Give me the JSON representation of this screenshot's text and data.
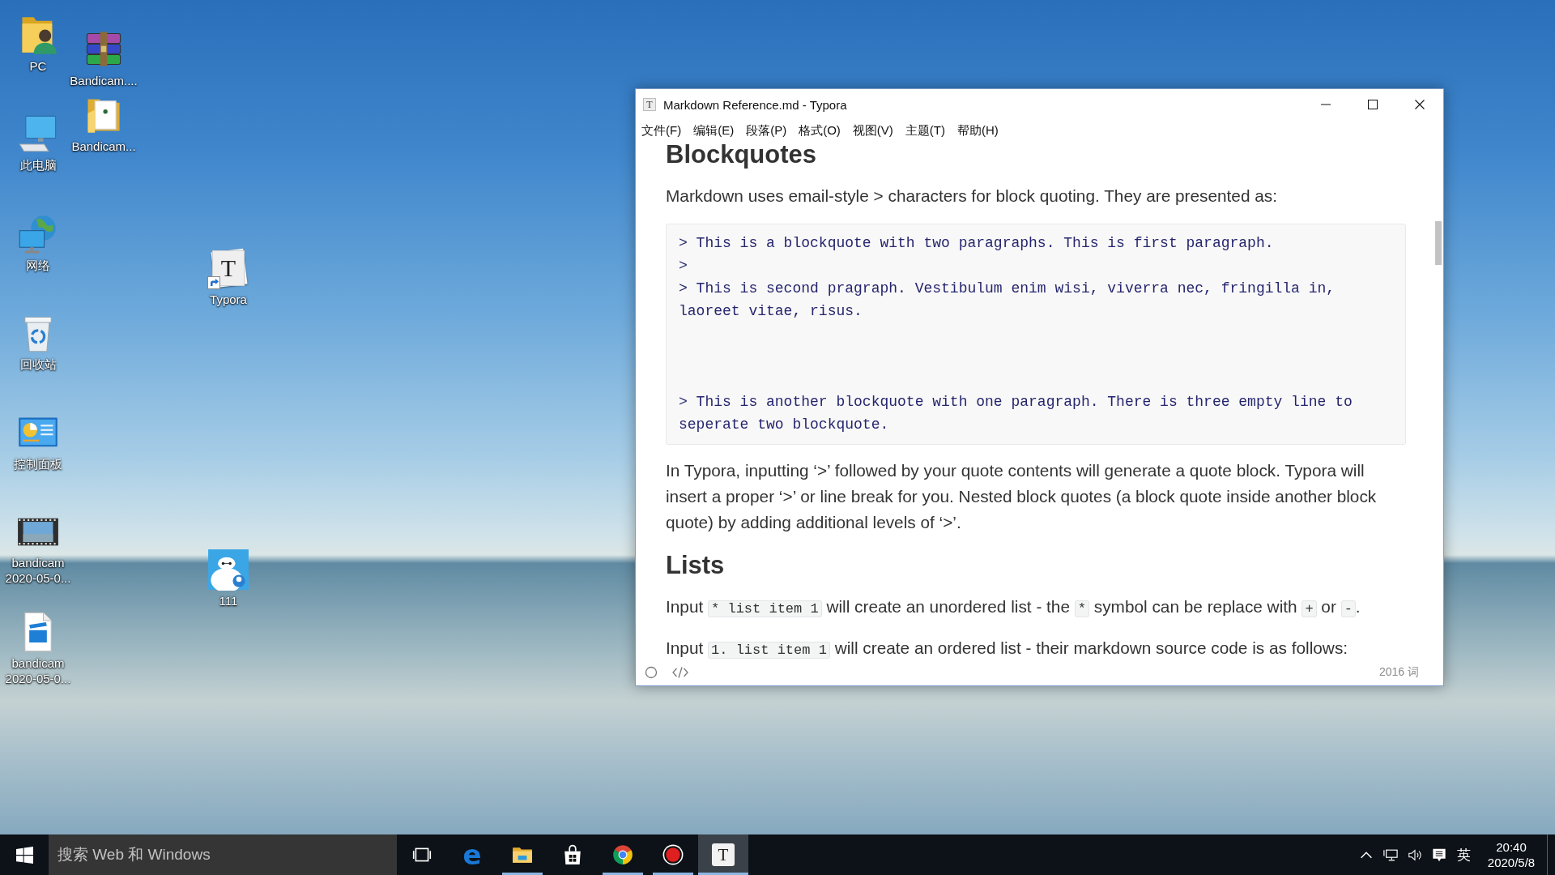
{
  "desktop": {
    "icons": [
      {
        "kind": "userfolder",
        "label": "PC",
        "shortcut": false
      },
      {
        "kind": "archive",
        "label": "Bandicam....",
        "shortcut": false
      },
      {
        "kind": "folder",
        "label": "Bandicam...",
        "shortcut": false
      },
      {
        "kind": "computer",
        "label": "此电脑",
        "shortcut": false
      },
      {
        "kind": "network",
        "label": "网络",
        "shortcut": false
      },
      {
        "kind": "document",
        "glyph": "T",
        "label": "Typora",
        "shortcut": true
      },
      {
        "kind": "recyclebin",
        "label": "回收站",
        "shortcut": false
      },
      {
        "kind": "controlpanel",
        "label": "控制面板",
        "shortcut": false
      },
      {
        "kind": "video",
        "label": "bandicam 2020-05-0...",
        "shortcut": false
      },
      {
        "kind": "image",
        "label": "111",
        "shortcut": false
      },
      {
        "kind": "movie",
        "label": "bandicam 2020-05-0...",
        "shortcut": false
      }
    ]
  },
  "window": {
    "app_icon": {
      "glyph": "T"
    },
    "title": "Markdown Reference.md - Typora",
    "menu": [
      "文件(F)",
      "编辑(E)",
      "段落(P)",
      "格式(O)",
      "视图(V)",
      "主题(T)",
      "帮助(H)"
    ],
    "document": {
      "blocks": [
        {
          "kind": "heading",
          "text": "Blockquotes"
        },
        {
          "kind": "paragraph",
          "segments": [
            {
              "kind": "text",
              "text": "Markdown uses email-style > characters for block quoting. They are presented as:"
            }
          ]
        },
        {
          "kind": "code",
          "text": "> This is a blockquote with two paragraphs. This is first paragraph.\n>\n> This is second pragraph. Vestibulum enim wisi, viverra nec, fringilla in, laoreet vitae, risus.\n\n\n\n> This is another blockquote with one paragraph. There is three empty line to seperate two blockquote."
        },
        {
          "kind": "paragraph",
          "segments": [
            {
              "kind": "text",
              "text": "In Typora, inputting ‘>’ followed by your quote contents will generate a quote block. Typora will insert a proper ‘>’ or line break for you. Nested block quotes (a block quote inside another block quote) by adding additional levels of ‘>’."
            }
          ]
        },
        {
          "kind": "heading",
          "text": "Lists"
        },
        {
          "kind": "paragraph",
          "segments": [
            {
              "kind": "text",
              "text": "Input "
            },
            {
              "kind": "code",
              "text": "* list item 1"
            },
            {
              "kind": "text",
              "text": " will create an unordered list - the "
            },
            {
              "kind": "code",
              "text": "*"
            },
            {
              "kind": "text",
              "text": " symbol can be replace with "
            },
            {
              "kind": "code",
              "text": "+"
            },
            {
              "kind": "text",
              "text": " or "
            },
            {
              "kind": "code",
              "text": "-"
            },
            {
              "kind": "text",
              "text": "."
            }
          ]
        },
        {
          "kind": "paragraph",
          "segments": [
            {
              "kind": "text",
              "text": "Input "
            },
            {
              "kind": "code",
              "text": "1. list item 1"
            },
            {
              "kind": "text",
              "text": " will create an ordered list - their markdown source code is as follows:"
            }
          ]
        }
      ]
    },
    "status_bar": {
      "word_count": "2016 词"
    }
  },
  "taskbar": {
    "search": {
      "placeholder": "搜索 Web 和 Windows"
    },
    "apps": [
      {
        "kind": "letter",
        "glyph": "e",
        "running": false,
        "selected": false
      },
      {
        "kind": "folder",
        "running": true,
        "selected": false
      },
      {
        "kind": "bag",
        "running": false,
        "selected": false
      },
      {
        "kind": "wheel",
        "running": true,
        "selected": false
      },
      {
        "kind": "record",
        "running": true,
        "selected": false
      },
      {
        "kind": "page",
        "glyph": "T",
        "running": true,
        "selected": true
      }
    ],
    "tray": {
      "input_method": "英",
      "time": "20:40",
      "date": "2020/5/8"
    }
  }
}
